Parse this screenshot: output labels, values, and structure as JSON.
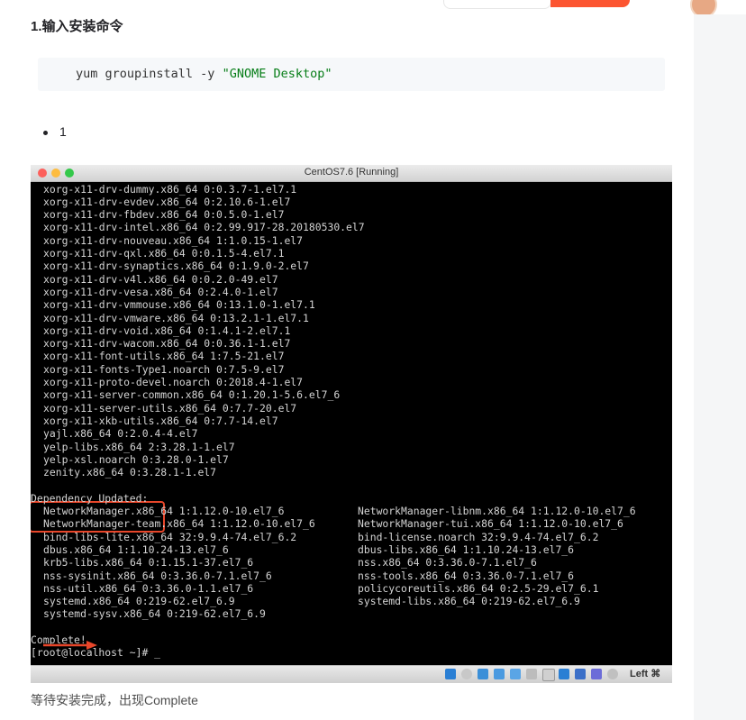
{
  "article": {
    "heading": "1.输入安装命令",
    "code": {
      "prefix": "yum groupinstall -y ",
      "string": "\"GNOME Desktop\""
    },
    "list_items": [
      "1"
    ],
    "caption": "等待安装完成，出现Complete"
  },
  "vm": {
    "title": "CentOS7.6 [Running]",
    "host_key": "Left ⌘",
    "packages_installed": [
      "xorg-x11-drv-dummy.x86_64 0:0.3.7-1.el7.1",
      "xorg-x11-drv-evdev.x86_64 0:2.10.6-1.el7",
      "xorg-x11-drv-fbdev.x86_64 0:0.5.0-1.el7",
      "xorg-x11-drv-intel.x86_64 0:2.99.917-28.20180530.el7",
      "xorg-x11-drv-nouveau.x86_64 1:1.0.15-1.el7",
      "xorg-x11-drv-qxl.x86_64 0:0.1.5-4.el7.1",
      "xorg-x11-drv-synaptics.x86_64 0:1.9.0-2.el7",
      "xorg-x11-drv-v4l.x86_64 0:0.2.0-49.el7",
      "xorg-x11-drv-vesa.x86_64 0:2.4.0-1.el7",
      "xorg-x11-drv-vmmouse.x86_64 0:13.1.0-1.el7.1",
      "xorg-x11-drv-vmware.x86_64 0:13.2.1-1.el7.1",
      "xorg-x11-drv-void.x86_64 0:1.4.1-2.el7.1",
      "xorg-x11-drv-wacom.x86_64 0:0.36.1-1.el7",
      "xorg-x11-font-utils.x86_64 1:7.5-21.el7",
      "xorg-x11-fonts-Type1.noarch 0:7.5-9.el7",
      "xorg-x11-proto-devel.noarch 0:2018.4-1.el7",
      "xorg-x11-server-common.x86_64 0:1.20.1-5.6.el7_6",
      "xorg-x11-server-utils.x86_64 0:7.7-20.el7",
      "xorg-x11-xkb-utils.x86_64 0:7.7-14.el7",
      "yajl.x86_64 0:2.0.4-4.el7",
      "yelp-libs.x86_64 2:3.28.1-1.el7",
      "yelp-xsl.noarch 0:3.28.0-1.el7",
      "zenity.x86_64 0:3.28.1-1.el7"
    ],
    "dependency_header": "Dependency Updated:",
    "dependency_left": [
      "NetworkManager.x86_64 1:1.12.0-10.el7_6",
      "NetworkManager-team.x86_64 1:1.12.0-10.el7_6",
      "bind-libs-lite.x86_64 32:9.9.4-74.el7_6.2",
      "dbus.x86_64 1:1.10.24-13.el7_6",
      "krb5-libs.x86_64 0:1.15.1-37.el7_6",
      "nss-sysinit.x86_64 0:3.36.0-7.1.el7_6",
      "nss-util.x86_64 0:3.36.0-1.1.el7_6",
      "systemd.x86_64 0:219-62.el7_6.9",
      "systemd-sysv.x86_64 0:219-62.el7_6.9"
    ],
    "dependency_right": [
      "NetworkManager-libnm.x86_64 1:1.12.0-10.el7_6",
      "NetworkManager-tui.x86_64 1:1.12.0-10.el7_6",
      "bind-license.noarch 32:9.9.4-74.el7_6.2",
      "dbus-libs.x86_64 1:1.10.24-13.el7_6",
      "nss.x86_64 0:3.36.0-7.1.el7_6",
      "nss-tools.x86_64 0:3.36.0-7.1.el7_6",
      "policycoreutils.x86_64 0:2.5-29.el7_6.1",
      "systemd-libs.x86_64 0:219-62.el7_6.9"
    ],
    "complete": "Complete!",
    "prompt": "[root@localhost ~]# _"
  },
  "colors": {
    "accent": "#fc5531",
    "highlight_box": "#e8462a",
    "terminal_bg": "#000000",
    "terminal_fg": "#d4d4d4"
  }
}
